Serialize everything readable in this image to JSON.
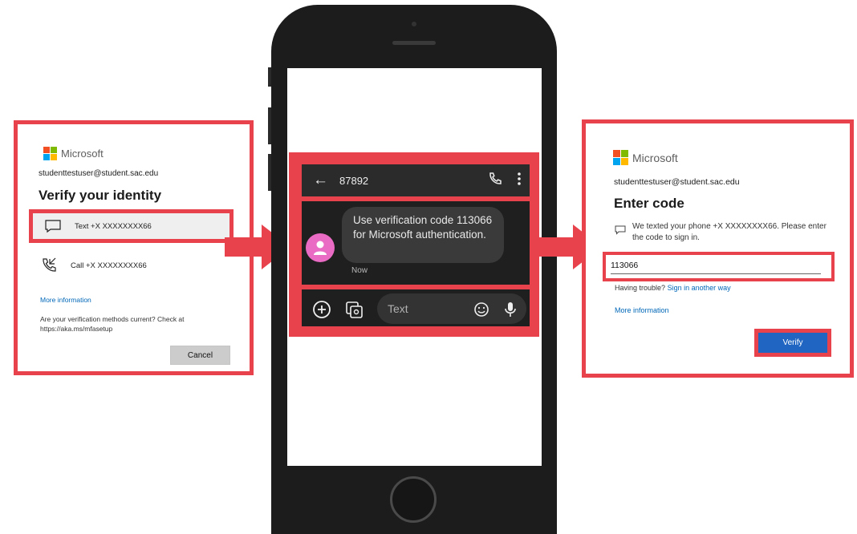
{
  "left_panel": {
    "brand": "Microsoft",
    "account": "studenttestuser@student.sac.edu",
    "title": "Verify your identity",
    "option_text_label": "Text +X XXXXXXXX66",
    "option_call_label": "Call +X XXXXXXXX66",
    "more_info": "More information",
    "current_question": "Are your verification methods current? Check at https://aka.ms/mfasetup",
    "cancel_label": "Cancel"
  },
  "phone": {
    "sender": "87892",
    "message": "Use verification code 113066 for Microsoft authentication.",
    "message_time": "Now",
    "compose_placeholder": "Text",
    "avatar_color": "#e96bc3"
  },
  "right_panel": {
    "brand": "Microsoft",
    "account": "studenttestuser@student.sac.edu",
    "title": "Enter code",
    "description": "We texted your phone +X XXXXXXXX66. Please enter the code to sign in.",
    "code_value": "113066",
    "trouble_text": "Having trouble?",
    "trouble_link": "Sign in another way",
    "more_info": "More information",
    "verify_label": "Verify"
  },
  "colors": {
    "highlight": "#e8434c",
    "primary_button": "#1f65c1",
    "link": "#0067b8"
  }
}
